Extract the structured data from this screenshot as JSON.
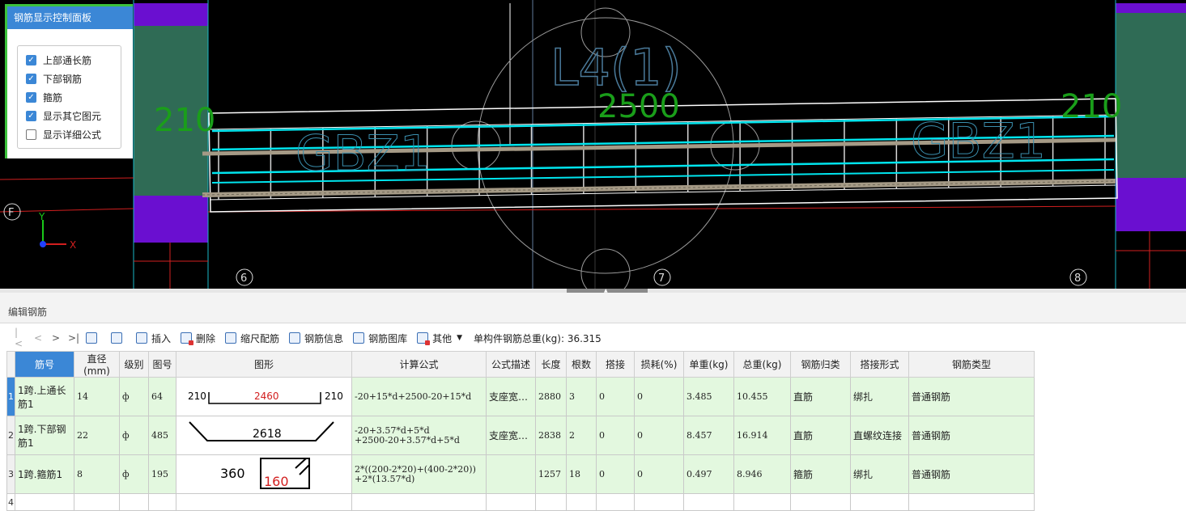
{
  "viewport": {
    "span_label": "L4(1)",
    "mid_length": "2500",
    "left_dim": "210",
    "right_dim": "210",
    "left_support": "GBZ1",
    "right_support": "GBZ1",
    "grid_axes": [
      "F",
      "6",
      "7",
      "8"
    ],
    "axis_y": "Y",
    "axis_x": "X"
  },
  "control_panel": {
    "title": "钢筋显示控制面板",
    "options": [
      {
        "label": "上部通长筋",
        "checked": true
      },
      {
        "label": "下部钢筋",
        "checked": true
      },
      {
        "label": "箍筋",
        "checked": true
      },
      {
        "label": "显示其它图元",
        "checked": true
      },
      {
        "label": "显示详细公式",
        "checked": false
      }
    ]
  },
  "editor": {
    "title": "编辑钢筋",
    "nav": [
      "|<",
      "<",
      ">",
      ">|"
    ],
    "toolbar": {
      "insert": "插入",
      "delete": "删除",
      "scale_config": "缩尺配筋",
      "rebar_info": "钢筋信息",
      "rebar_library": "钢筋图库",
      "other": "其他",
      "total_weight_label": "单构件钢筋总重(kg):",
      "total_weight_value": "36.315"
    },
    "columns": [
      "筋号",
      "直径(mm)",
      "级别",
      "图号",
      "图形",
      "计算公式",
      "公式描述",
      "长度",
      "根数",
      "搭接",
      "损耗(%)",
      "单重(kg)",
      "总重(kg)",
      "钢筋归类",
      "搭接形式",
      "钢筋类型"
    ],
    "rows": [
      {
        "num": "1",
        "name": "1跨.上通长筋1",
        "dia": "14",
        "grade": "ф",
        "fig": "64",
        "shape": {
          "left": "210",
          "mid": "2460",
          "right": "210"
        },
        "formula1": "-20+15*d+2500-20+15*d",
        "formula2": "",
        "desc": "支座宽…",
        "length": "2880",
        "count": "3",
        "lap": "0",
        "loss": "0",
        "unit_w": "3.485",
        "total_w": "10.455",
        "category": "直筋",
        "lap_type": "绑扎",
        "type": "普通钢筋"
      },
      {
        "num": "2",
        "name": "1跨.下部钢筋1",
        "dia": "22",
        "grade": "ф",
        "fig": "485",
        "shape": {
          "mid": "2618"
        },
        "formula1": "-20+3.57*d+5*d",
        "formula2": "+2500-20+3.57*d+5*d",
        "desc": "支座宽…",
        "length": "2838",
        "count": "2",
        "lap": "0",
        "loss": "0",
        "unit_w": "8.457",
        "total_w": "16.914",
        "category": "直筋",
        "lap_type": "直螺纹连接",
        "type": "普通钢筋"
      },
      {
        "num": "3",
        "name": "1跨.箍筋1",
        "dia": "8",
        "grade": "ф",
        "fig": "195",
        "shape": {
          "width": "360",
          "height": "160"
        },
        "formula1": "2*((200-2*20)+(400-2*20))",
        "formula2": "+2*(13.57*d)",
        "desc": "",
        "length": "1257",
        "count": "18",
        "lap": "0",
        "loss": "0",
        "unit_w": "0.497",
        "total_w": "8.946",
        "category": "箍筋",
        "lap_type": "绑扎",
        "type": "普通钢筋"
      }
    ],
    "empty_row_num": "4"
  },
  "colors": {
    "panel_title": "#3b87d6",
    "row_bg": "#e3f8df",
    "rebar_cyan": "#00e5ee",
    "dim_green": "#1a9e1a",
    "support_purple": "#6a0fd0",
    "support_teal": "#2f6b55"
  }
}
